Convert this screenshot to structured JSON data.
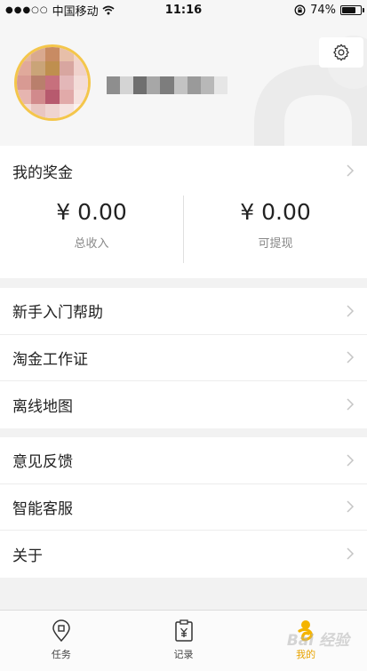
{
  "status_bar": {
    "carrier": "中国移动",
    "time": "11:16",
    "battery": "74%",
    "battery_level": 0.74
  },
  "profile": {
    "avatar_colors": [
      "#e4b6a0",
      "#d9a98f",
      "#c88b63",
      "#e7bfa9",
      "#f1d4c9",
      "#e0a99b",
      "#caa478",
      "#bf8f4f",
      "#d8a6a0",
      "#f0d2cc",
      "#d89a93",
      "#b97f6c",
      "#c7707d",
      "#e3b7b8",
      "#f3dcd8",
      "#e6b5b0",
      "#d18a8c",
      "#b75a6e",
      "#e1aaa9",
      "#f6e2de",
      "#f3dcda",
      "#e9c6c2",
      "#efd4d0",
      "#f5e3e0",
      "#faf0ee"
    ],
    "name_colors": [
      "#8e8e8e",
      "#d4d4d4",
      "#6f6f6f",
      "#a7a7a7",
      "#7d7d7d",
      "#c3c3c3",
      "#9a9a9a",
      "#b8b8b8",
      "#e6e6e6"
    ]
  },
  "bonus": {
    "title": "我的奖金",
    "items": [
      {
        "amount": "¥ 0.00",
        "label": "总收入"
      },
      {
        "amount": "¥ 0.00",
        "label": "可提现"
      }
    ]
  },
  "menu_group_1": [
    {
      "label": "新手入门帮助"
    },
    {
      "label": "淘金工作证"
    },
    {
      "label": "离线地图"
    }
  ],
  "menu_group_2": [
    {
      "label": "意见反馈"
    },
    {
      "label": "智能客服"
    },
    {
      "label": "关于"
    }
  ],
  "tabs": [
    {
      "label": "任务",
      "icon": "location-pin-icon"
    },
    {
      "label": "记录",
      "icon": "clipboard-yen-icon"
    },
    {
      "label": "我的",
      "icon": "person-icon",
      "active": true
    }
  ],
  "watermark": "Bai 经验",
  "colors": {
    "accent": "#e8a300",
    "avatar_ring": "#f4c64b"
  }
}
